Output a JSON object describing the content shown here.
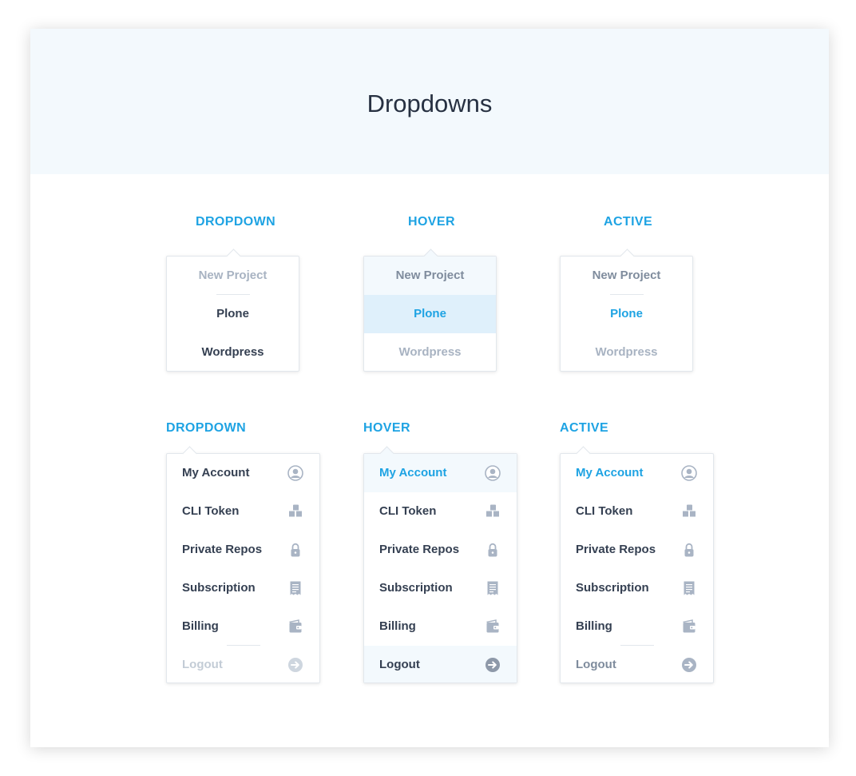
{
  "page": {
    "title": "Dropdowns"
  },
  "simple_menus": [
    {
      "label": "DROPDOWN",
      "items": [
        "New Project",
        "Plone",
        "Wordpress"
      ]
    },
    {
      "label": "HOVER",
      "items": [
        "New Project",
        "Plone",
        "Wordpress"
      ]
    },
    {
      "label": "ACTIVE",
      "items": [
        "New Project",
        "Plone",
        "Wordpress"
      ]
    }
  ],
  "account_menus": [
    {
      "label": "DROPDOWN",
      "items": [
        "My Account",
        "CLI Token",
        "Private Repos",
        "Subscription",
        "Billing",
        "Logout"
      ]
    },
    {
      "label": "HOVER",
      "items": [
        "My Account",
        "CLI Token",
        "Private Repos",
        "Subscription",
        "Billing",
        "Logout"
      ]
    },
    {
      "label": "ACTIVE",
      "items": [
        "My Account",
        "CLI Token",
        "Private Repos",
        "Subscription",
        "Billing",
        "Logout"
      ]
    }
  ],
  "icons": [
    "user-icon",
    "cubes-icon",
    "lock-icon",
    "receipt-icon",
    "wallet-icon",
    "arrow-right-circle-icon"
  ],
  "colors": {
    "accent": "#1ea3e3",
    "text": "#354052",
    "muted": "#a8b3c2",
    "header_bg": "#f3f9fd",
    "hover_bg": "#dff0fb",
    "icon": "#a9b4c4"
  }
}
